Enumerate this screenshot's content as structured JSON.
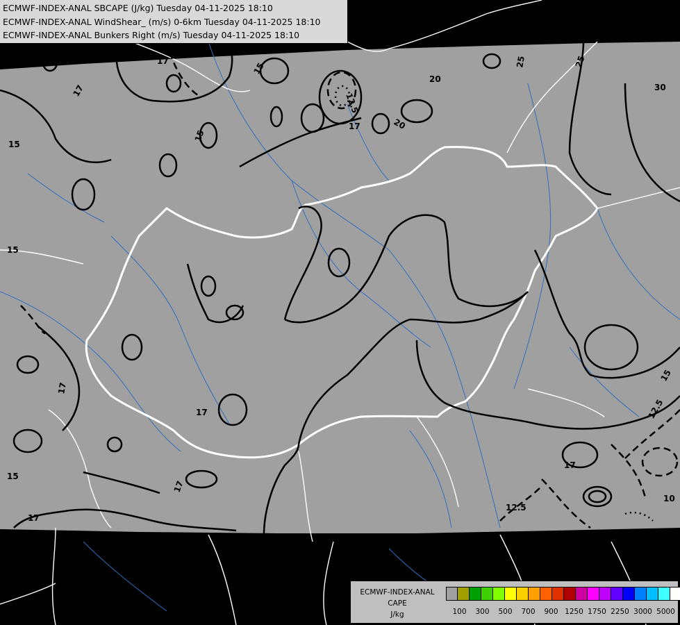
{
  "header": {
    "line1": "ECMWF-INDEX-ANAL SBCAPE (J/kg) Tuesday 04-11-2025 18:10",
    "line2": "ECMWF-INDEX-ANAL WindShear_ (m/s) 0-6km Tuesday 04-11-2025 18:10",
    "line3": "ECMWF-INDEX-ANAL Bunkers Right (m/s) Tuesday 04-11-2025 18:10"
  },
  "legend": {
    "title_line1": "ECMWF-INDEX-ANAL",
    "title_line2": "CAPE",
    "title_line3": "J/kg",
    "colors": [
      "#a0a0a0",
      "#a0a000",
      "#00a000",
      "#40d000",
      "#80ff00",
      "#ffff00",
      "#ffd000",
      "#ffa000",
      "#ff6000",
      "#e03000",
      "#b00000",
      "#d000a0",
      "#ff00ff",
      "#c000ff",
      "#6000ff",
      "#0000ff",
      "#0080ff",
      "#00c0ff",
      "#40ffff",
      "#ffffff"
    ],
    "tick_labels": [
      "100",
      "300",
      "500",
      "700",
      "900",
      "1250",
      "1750",
      "2250",
      "3000",
      "5000"
    ]
  },
  "contour_labels": [
    "15",
    "17",
    "12.5",
    "20",
    "25",
    "30",
    "15",
    "17",
    "15",
    "17",
    "17",
    "15",
    "20",
    "17",
    "15",
    "25",
    "12.5",
    "15",
    "17",
    "15",
    "17",
    "17",
    "12.5",
    "10"
  ],
  "map_colors": {
    "data_area": "#a0a0a0",
    "outside": "#000000",
    "borders": "#ffffff",
    "rivers": "#2f6fbf",
    "contours": "#000000"
  }
}
